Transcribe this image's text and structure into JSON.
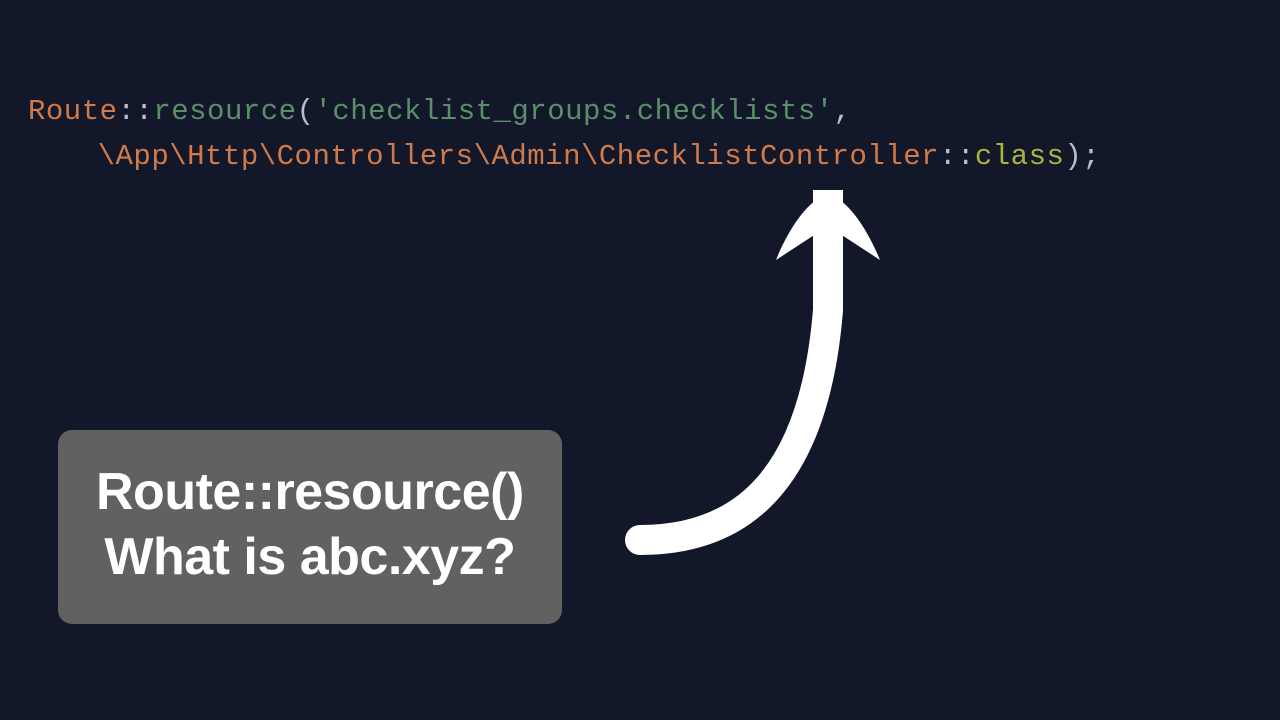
{
  "code": {
    "line1": {
      "class": "Route",
      "scope": "::",
      "method": "resource",
      "open": "(",
      "string_open": "'",
      "string_body": "checklist_groups.checklists",
      "string_close": "'",
      "comma": ","
    },
    "line2": {
      "ns_prefix": "\\App\\Http\\Controllers\\Admin\\",
      "controller": "ChecklistController",
      "scope": "::",
      "keyword": "class",
      "close": ");"
    }
  },
  "callout": {
    "line1": "Route::resource()",
    "line2": "What is abc.xyz?"
  }
}
